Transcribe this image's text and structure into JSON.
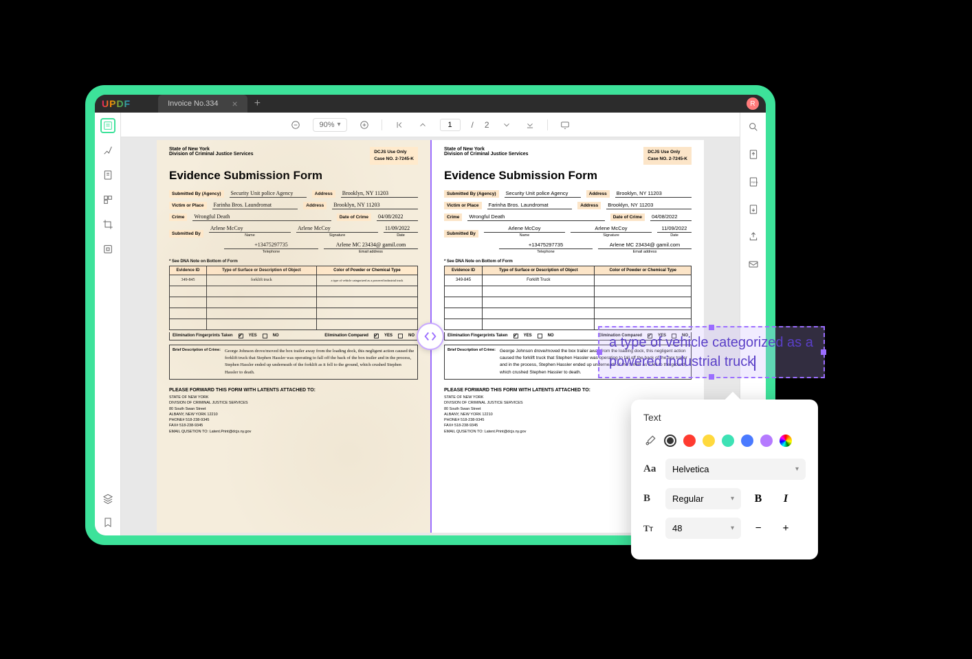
{
  "app": {
    "logo": "UPDF"
  },
  "tab": {
    "title": "Invoice No.334",
    "avatar_initial": "R"
  },
  "toolbar": {
    "zoom": "90%",
    "current_page": "1",
    "page_sep": "/",
    "total_pages": "2"
  },
  "document": {
    "state": "State of New York",
    "division": "Division of Criminal Justice Services",
    "dcjs_title": "DCJS Use Only",
    "case_no": "Case NO.  2-7245-K",
    "form_title": "Evidence Submission Form",
    "labels": {
      "submitted_by_agency": "Submitted By (Agency)",
      "address": "Address",
      "victim_place": "Victim or Place",
      "crime": "Crime",
      "date_of_crime": "Date of Crime",
      "submitted_by": "Submitted By",
      "name": "Name",
      "signature": "Signature",
      "date": "Date",
      "telephone": "Telephone",
      "email": "Email address",
      "dna_note": "* See DNA Note on Bottom of Form",
      "evidence_id": "Evidence ID",
      "surface": "Type of Surface or Description of Object",
      "powder": "Color of Powder or Chemical Type",
      "elim_taken": "Elimination Fingerprints Taken",
      "elim_compared": "Elimination Compared",
      "yes": "YES",
      "no": "NO",
      "brief_desc": "Brief Description of Crime:",
      "forward": "PLEASE FORWARD THIS FORM WITH LATENTS ATTACHED TO:"
    },
    "left": {
      "agency": "Security Unit police Agency",
      "address1": "Brooklyn, NY 11203",
      "victim": "Farinha Bros. Laundromat",
      "address2": "Brooklyn, NY 11203",
      "crime": "Wrongful Death",
      "date_crime": "04/08/2022",
      "name": "Arlene McCoy",
      "signature": "Arlene McCoy",
      "date": "11/09/2022",
      "phone": "+13475297735",
      "email": "Arlene MC 23434@ gamil.com",
      "ev_id": "349-845",
      "ev_surface": "forklift truck",
      "ev_powder": "a type of vehicle categorized as a powered industrial truck",
      "description": "George Johnson drove/moved the box trailer away from the loading dock, this negligent action caused the forklift truck that Stephen Hassler was operating to fall off the back of the box trailer and in the process, Stephen Hassler ended up underneath of the forklift as it fell to the ground, which crushed Stephen Hassler to death."
    },
    "right": {
      "agency": "Security Unit police Agency",
      "address1": "Brooklyn, NY 11203",
      "victim": "Farinha Bros. Laundromat",
      "address2": "Brooklyn, NY 11203",
      "crime": "Wrongful Death",
      "date_crime": "04/08/2022",
      "name": "Arlene McCoy",
      "signature": "Arlene McCoy",
      "date": "11/09/2022",
      "phone": "+13475297735",
      "email": "Arlene MC 23434@ gamil.com",
      "ev_id": "349-845",
      "ev_surface": "Forklift Truck",
      "description": "George Johnson drove/moved the box trailer away from the loading dock, this negligent action caused the forklift truck that Stephen Hassler was operating to fall off the back of the box trailer and in the process, Stephen Hassler ended up underneath of the forklift as it fell to the ground, which crushed Stephen Hassler to death."
    },
    "footer": {
      "l1": "STATE OF NEW YORK",
      "l2": "DIVISION OF CRIMINAL JUSTICE SERVICES",
      "l3": "80 South Swan Street",
      "l4": "ALBANY, NEW YORK 12210",
      "l5": "PHONE# 518-238-9345",
      "l6": "FAX# 518-238-9345",
      "l7": "EMAIL QUSETION TO: Latent.Print@dcjs.ny.gov"
    }
  },
  "callout": {
    "text": "a type of vehicle categorized as a powered industrial truck"
  },
  "text_panel": {
    "title": "Text",
    "font": "Helvetica",
    "weight": "Regular",
    "size": "48",
    "colors": {
      "black": "#000000",
      "red": "#ff3b30",
      "yellow": "#ffd93d",
      "teal": "#3de2b5",
      "blue": "#4a7aff",
      "purple": "#b57aff",
      "rainbow": "rainbow"
    }
  }
}
